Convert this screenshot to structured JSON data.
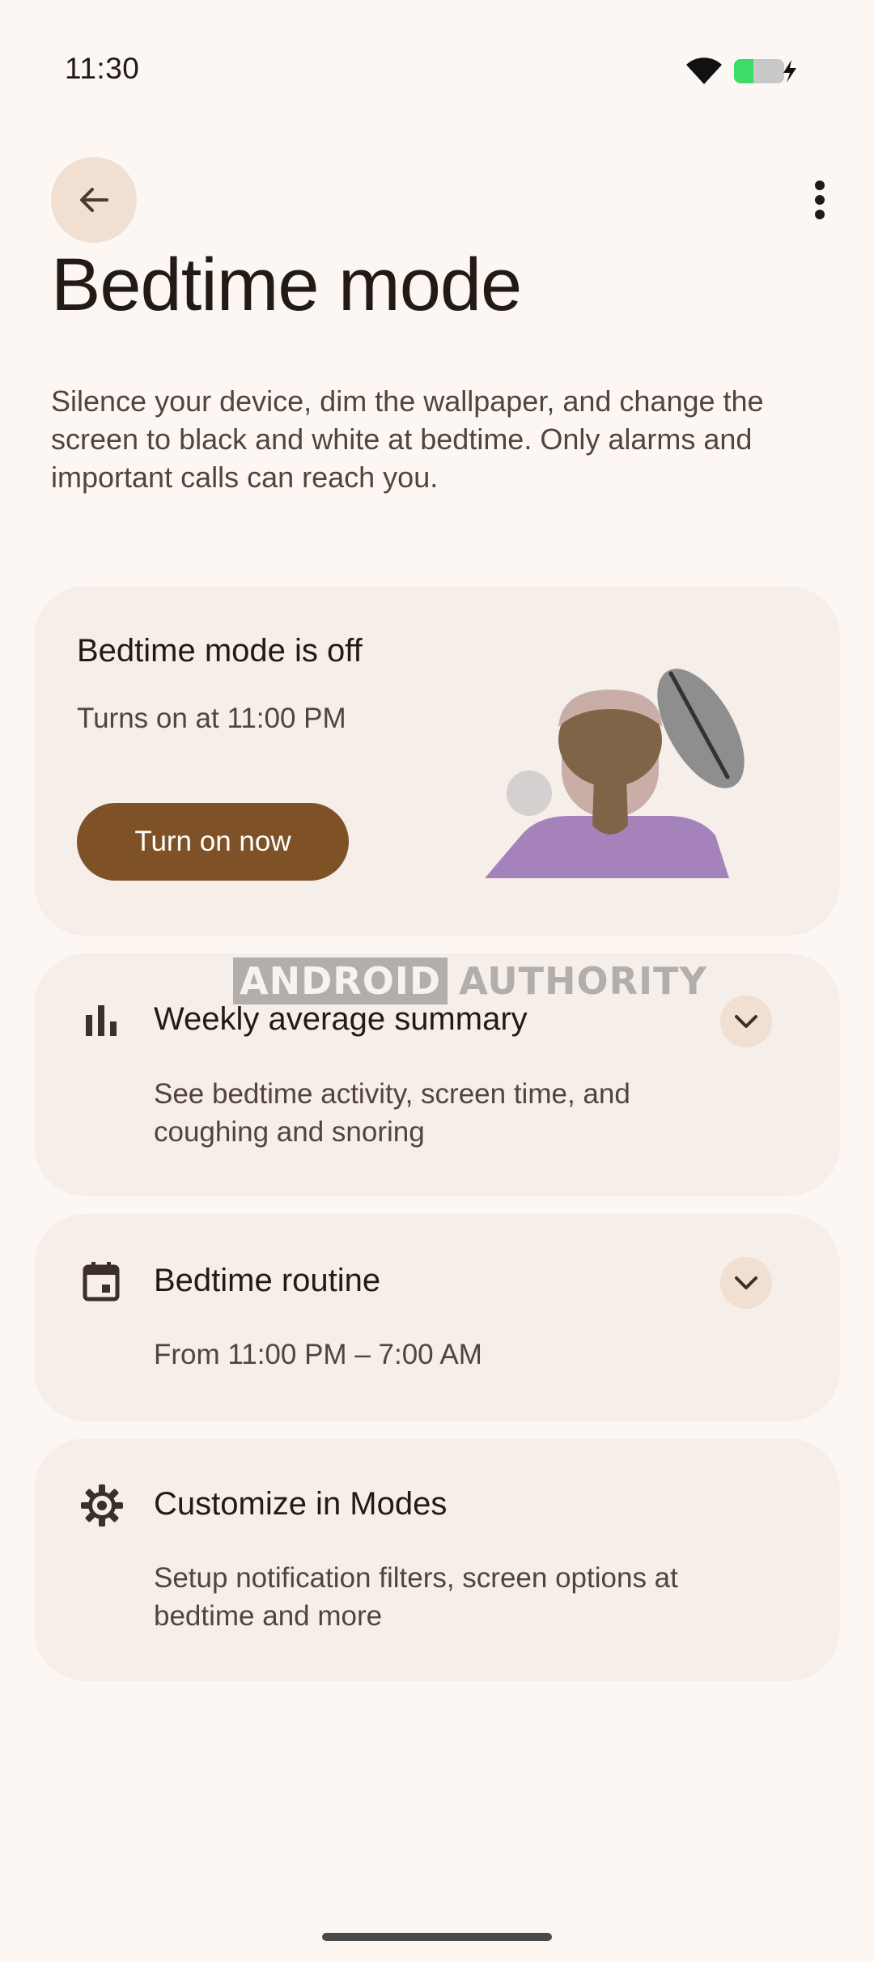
{
  "status_bar": {
    "time": "11:30",
    "wifi_icon": "wifi-icon",
    "battery_icon": "battery-charging-icon",
    "battery_color": "#3ddc68"
  },
  "app_bar": {
    "back_icon": "arrow-back-icon",
    "more_icon": "more-vert-icon"
  },
  "page": {
    "title": "Bedtime mode",
    "description": "Silence your device, dim the wallpaper, and change the screen to black and white at bedtime. Only alarms and important calls can reach you."
  },
  "status_card": {
    "title": "Bedtime mode is off",
    "subtitle": "Turns on at 11:00 PM",
    "button_label": "Turn on now"
  },
  "weekly_card": {
    "icon": "bar-chart-icon",
    "title": "Weekly average summary",
    "description": "See bedtime activity, screen time, and coughing and snoring",
    "expand_icon": "chevron-down-icon"
  },
  "routine_card": {
    "icon": "calendar-icon",
    "title": "Bedtime routine",
    "description": "From 11:00 PM – 7:00 AM",
    "expand_icon": "chevron-down-icon"
  },
  "modes_card": {
    "icon": "gear-icon",
    "title": "Customize in Modes",
    "description": "Setup notification filters, screen options at bedtime and more"
  },
  "watermark": {
    "part1": "ANDROID",
    "part2": "AUTHORITY"
  },
  "colors": {
    "background": "#fdf7f4",
    "card": "#f6eee9",
    "accent_button": "#7f5126",
    "tonal": "#f1dfd1"
  }
}
